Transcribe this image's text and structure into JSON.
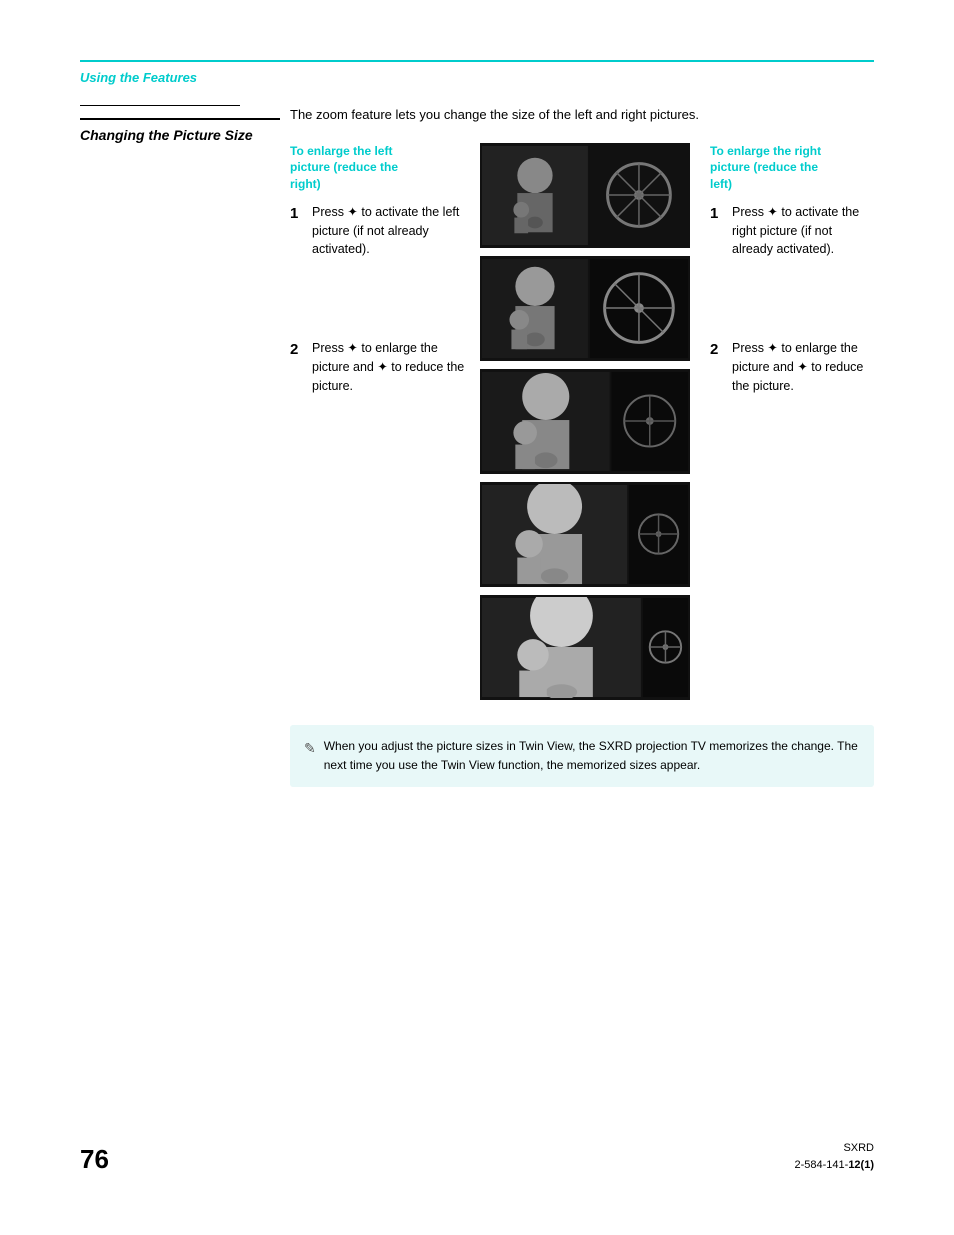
{
  "header": {
    "section_label": "Using the Features"
  },
  "section": {
    "title": "Changing the\nPicture Size",
    "intro_text": "The zoom feature lets you change the size of the left and right pictures."
  },
  "left_column": {
    "heading": "To enlarge the left\npicture (reduce the\nright)",
    "step1_text": "Press ✦ to activate the left picture (if not already activated).",
    "step2_text": "Press ✦ to enlarge the picture and ✦ to reduce the picture."
  },
  "right_column": {
    "heading": "To enlarge the right\npicture (reduce the\nleft)",
    "step1_text": "Press ✦ to activate the right picture (if not already activated).",
    "step2_text": "Press ✦ to enlarge the picture and ✦ to reduce the picture."
  },
  "note": {
    "text": "When you adjust the picture sizes in Twin View, the SXRD projection TV memorizes the change. The next time you use the Twin View function, the memorized sizes appear."
  },
  "footer": {
    "page_number": "76",
    "product": "SXRD",
    "part_number": "2-584-141-",
    "part_bold": "12(1)"
  },
  "steps": {
    "left_step1_num": "1",
    "left_step2_num": "2",
    "right_step1_num": "1",
    "right_step2_num": "2"
  }
}
